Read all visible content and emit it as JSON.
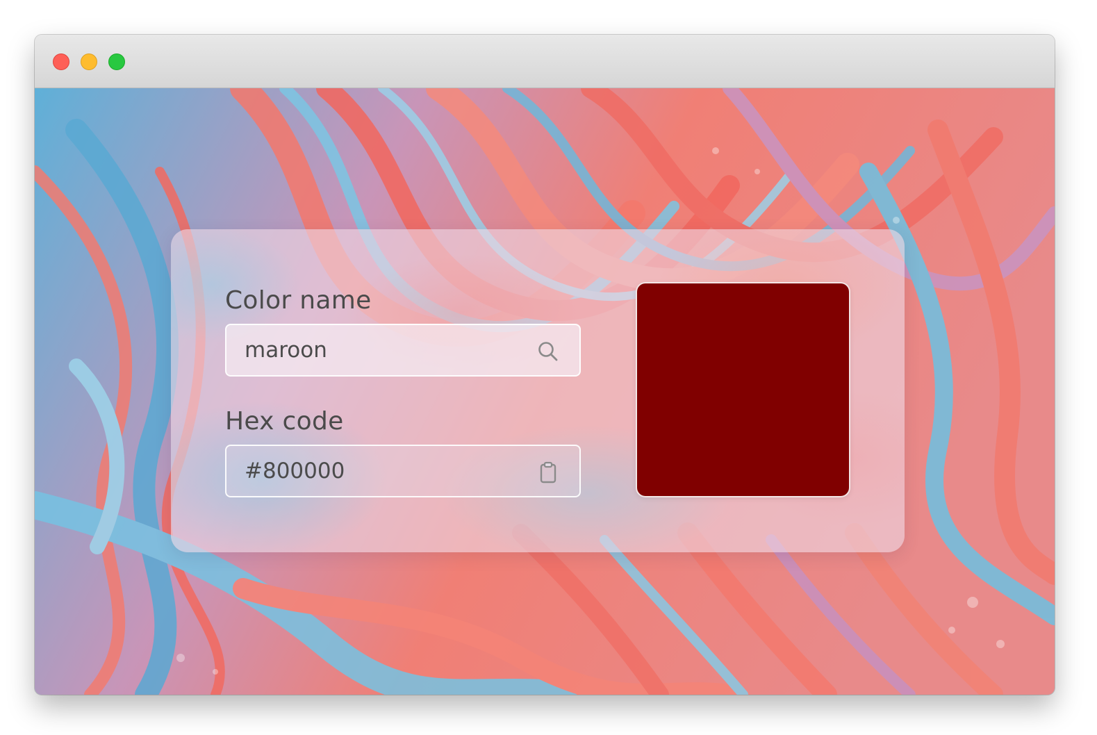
{
  "window": {
    "controls": [
      "close",
      "minimize",
      "zoom"
    ]
  },
  "form": {
    "color_name": {
      "label": "Color name",
      "value": "maroon",
      "icon": "search-icon"
    },
    "hex_code": {
      "label": "Hex code",
      "value": "#800000",
      "icon": "clipboard-icon"
    }
  },
  "preview": {
    "color": "#800000"
  },
  "theme": {
    "background_colors": [
      "#6fb2d2",
      "#f07a70",
      "#c98bb0"
    ]
  }
}
